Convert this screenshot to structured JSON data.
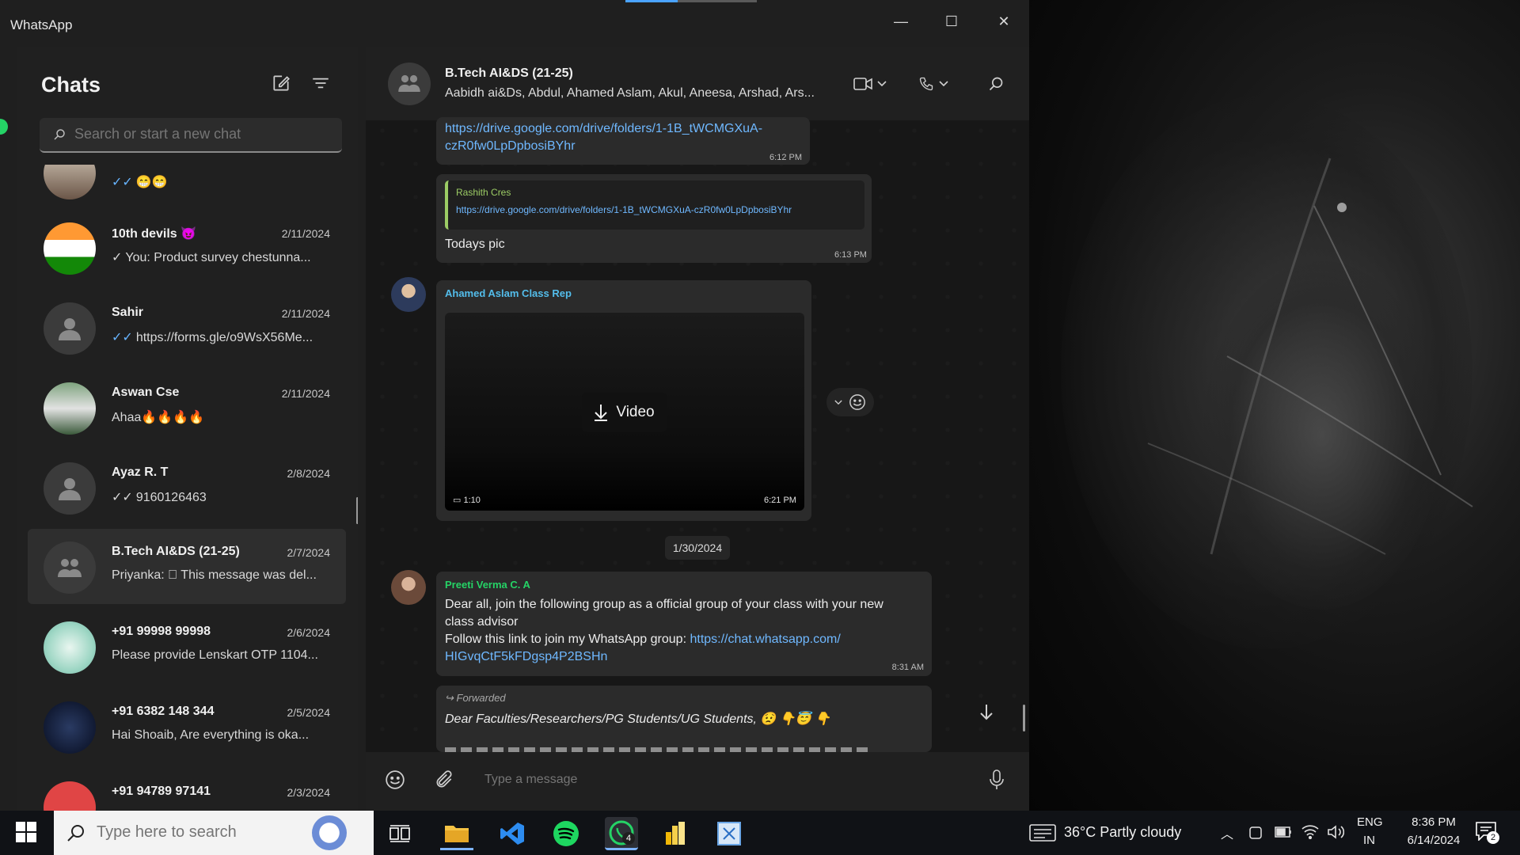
{
  "window": {
    "title": "WhatsApp",
    "minimize_glyph": "—",
    "maximize_glyph": "☐",
    "close_glyph": "✕"
  },
  "sidebar": {
    "title": "Chats",
    "search_placeholder": "Search or start a new chat",
    "chats": [
      {
        "name": "",
        "date": "",
        "tick": "✓✓",
        "preview": "😁😁",
        "avatar": "photo"
      },
      {
        "name": "10th devils 😈",
        "date": "2/11/2024",
        "tick": "✓",
        "preview": "You: Product survey chestunna...",
        "avatar": "flag"
      },
      {
        "name": "Sahir",
        "date": "2/11/2024",
        "tick": "✓✓",
        "preview": "https://forms.gle/o9WsX56Me...",
        "avatar": "generic"
      },
      {
        "name": "Aswan Cse",
        "date": "2/11/2024",
        "tick": "",
        "preview": "Ahaa🔥🔥🔥🔥",
        "avatar": "photo"
      },
      {
        "name": "Ayaz R. T",
        "date": "2/8/2024",
        "tick": "✓✓",
        "preview": "9160126463",
        "avatar": "generic"
      },
      {
        "name": "B.Tech AI&DS (21-25)",
        "date": "2/7/2024",
        "tick": "",
        "preview": "Priyanka: ⃠ This message was del...",
        "avatar": "group"
      },
      {
        "name": "+91 99998 99998",
        "date": "2/6/2024",
        "tick": "",
        "preview": "Please provide Lenskart OTP 1104...",
        "avatar": "lenskart"
      },
      {
        "name": "+91 6382 148 344",
        "date": "2/5/2024",
        "tick": "",
        "preview": "Hai Shoaib,  Are everything is oka...",
        "avatar": "welbosh"
      },
      {
        "name": "+91 94789 97141",
        "date": "2/3/2024",
        "tick": "",
        "preview": "",
        "avatar": "red"
      }
    ]
  },
  "conversation": {
    "group_name": "B.Tech AI&DS (21-25)",
    "members": "Aabidh ai&Ds, Abdul, Ahamed Aslam, Akul, Aneesa, Arshad, Ars...",
    "messages": {
      "m1_link": "https://drive.google.com/drive/folders/1-1B_tWCMGXuA-czR0fw0LpDpbosiBYhr",
      "m1_link_line1": "https://drive.google.com/drive/folders/1-1B_tWCMGXuA-",
      "m1_link_line2": "czR0fw0LpDpbosiBYhr",
      "m1_time": "6:12 PM",
      "m2_quote_author": "Rashith Cres",
      "m2_quote_text": "https://drive.google.com/drive/folders/1-1B_tWCMGXuA-czR0fw0LpDpbosiBYhr",
      "m2_text": "Todays pic",
      "m2_time": "6:13 PM",
      "m3_sender": "Ahamed Aslam Class Rep",
      "m3_video_label": "Video",
      "m3_duration": "1:10",
      "m3_time": "6:21 PM",
      "date_chip": "1/30/2024",
      "m4_sender": "Preeti Verma C. A",
      "m4_line1": "Dear all, join the following group as a official group of your class with your new",
      "m4_line2": "class advisor",
      "m4_line3_prefix": "Follow this link to join my WhatsApp group: ",
      "m4_link1": "https://chat.whatsapp.com/",
      "m4_link2": "HIGvqCtF5kFDgsp4P2BSHn",
      "m4_time": "8:31 AM",
      "m5_forwarded": "Forwarded",
      "m5_text": "Dear Faculties/Researchers/PG Students/UG Students, 😟 👇😇 👇"
    },
    "composer_placeholder": "Type a message"
  },
  "taskbar": {
    "search_placeholder": "Type here to search",
    "whatsapp_badge": "4",
    "weather": "36°C  Partly cloudy",
    "lang_line1": "ENG",
    "lang_line2": "IN",
    "clock_time": "8:36 PM",
    "clock_date": "6/14/2024",
    "notification_count": "2"
  },
  "colors": {
    "sender_blue": "#53bdeb",
    "sender_green": "#25d366",
    "link": "#6fb8ff",
    "tick": "#67b4ff"
  }
}
